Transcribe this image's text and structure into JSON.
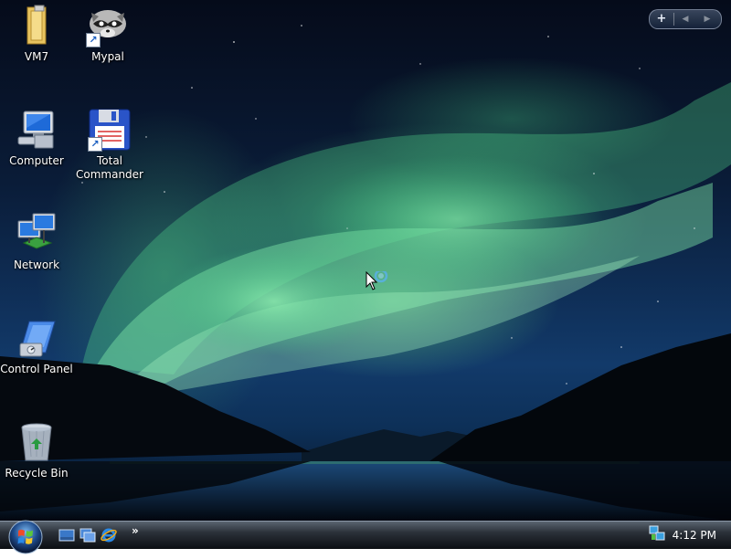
{
  "desktop": {
    "icons": [
      {
        "label": "VM7",
        "icon": "folder-icon",
        "shortcut": false
      },
      {
        "label": "Mypal",
        "icon": "mypal-raccoon-icon",
        "shortcut": true
      },
      {
        "label": "Computer",
        "icon": "computer-icon",
        "shortcut": false
      },
      {
        "label": "Total Commander",
        "icon": "floppy-disk-icon",
        "shortcut": true
      },
      {
        "label": "Network",
        "icon": "network-icon",
        "shortcut": false
      },
      {
        "label": "Control Panel",
        "icon": "control-panel-icon",
        "shortcut": false
      },
      {
        "label": "Recycle Bin",
        "icon": "recycle-bin-icon",
        "shortcut": false
      }
    ]
  },
  "gadget_bar": {
    "add": "+",
    "prev": "◀",
    "next": "▶"
  },
  "taskbar": {
    "quick_launch": [
      "show-desktop-icon",
      "switch-windows-icon",
      "internet-explorer-icon"
    ],
    "overflow": "»",
    "clock": "4:12 PM"
  },
  "colors": {
    "aurora": "#5de09a",
    "taskbar": "#1c2128"
  }
}
